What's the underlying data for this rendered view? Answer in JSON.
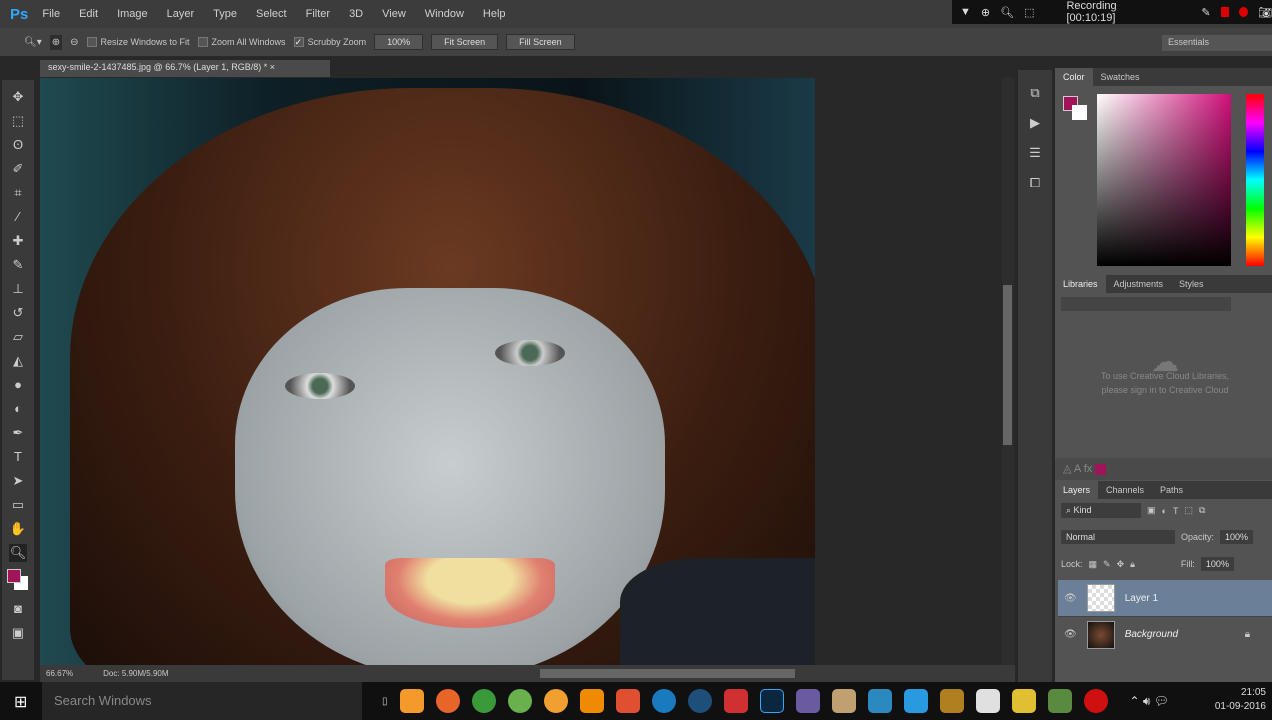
{
  "app": {
    "logo": "Ps",
    "menu": [
      "File",
      "Edit",
      "Image",
      "Layer",
      "Type",
      "Select",
      "Filter",
      "3D",
      "View",
      "Window",
      "Help"
    ]
  },
  "recorder": {
    "label": "Recording [00:10:19]"
  },
  "options": {
    "resize": "Resize Windows to Fit",
    "zoom_all": "Zoom All Windows",
    "scrubby": "Scrubby Zoom",
    "btn_100": "100%",
    "fit": "Fit Screen",
    "fill": "Fill Screen",
    "workspace": "Essentials"
  },
  "document": {
    "tab": "sexy-smile-2-1437485.jpg @ 66.7% (Layer 1, RGB/8) *",
    "close": "×"
  },
  "status": {
    "zoom": "66.67%",
    "doc": "Doc: 5.90M/5.90M"
  },
  "color_panel": {
    "tabs": [
      "Color",
      "Swatches"
    ],
    "fg": "#a0145a",
    "bg": "#ffffff"
  },
  "libraries": {
    "tabs": [
      "Libraries",
      "Adjustments",
      "Styles"
    ],
    "message1": "To use Creative Cloud Libraries,",
    "message2": "please sign in to Creative Cloud"
  },
  "layers": {
    "tabs": [
      "Layers",
      "Channels",
      "Paths"
    ],
    "filter": "Kind",
    "blend": "Normal",
    "opacity_label": "Opacity:",
    "opacity": "100%",
    "lock_label": "Lock:",
    "fill_label": "Fill:",
    "fill": "100%",
    "items": [
      {
        "name": "Layer 1"
      },
      {
        "name": "Background"
      }
    ]
  },
  "taskbar": {
    "search": "Search Windows",
    "time": "21:05",
    "date": "01-09-2016"
  }
}
